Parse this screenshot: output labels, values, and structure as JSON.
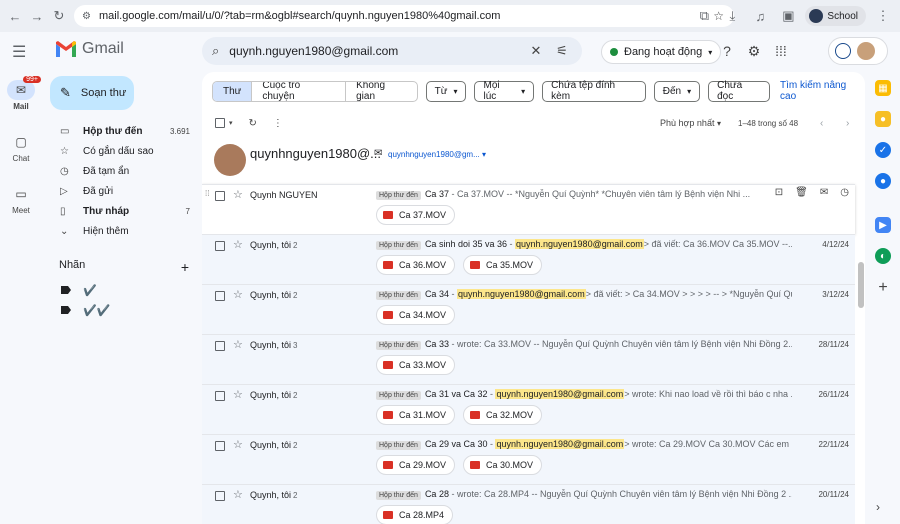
{
  "browser": {
    "url": "mail.google.com/mail/u/0/?tab=rm&ogbl#search/quynh.nguyen1980%40gmail.com",
    "profile": "School"
  },
  "app": {
    "logo": "Gmail",
    "search_query": "quynh.nguyen1980@gmail.com",
    "status": "Đang hoạt động"
  },
  "rail": [
    {
      "label": "Mail",
      "badge": "99+"
    },
    {
      "label": "Chat"
    },
    {
      "label": "Meet"
    }
  ],
  "compose_label": "Soạn thư",
  "nav": [
    {
      "icon": "inbox-icon",
      "glyph": "▭",
      "label": "Hộp thư đến",
      "count": "3.691",
      "bold": true
    },
    {
      "icon": "star-icon",
      "glyph": "☆",
      "label": "Có gắn dấu sao",
      "count": ""
    },
    {
      "icon": "clock-icon",
      "glyph": "◷",
      "label": "Đã tạm ẩn",
      "count": ""
    },
    {
      "icon": "send-icon",
      "glyph": "▷",
      "label": "Đã gửi",
      "count": ""
    },
    {
      "icon": "draft-icon",
      "glyph": "▯",
      "label": "Thư nháp",
      "count": "7",
      "bold": true
    },
    {
      "icon": "chevron-down-icon",
      "glyph": "⌄",
      "label": "Hiện thêm",
      "count": ""
    }
  ],
  "labels": {
    "title": "Nhãn",
    "items": [
      "✔️",
      "✔️✔️"
    ]
  },
  "filters": {
    "tabs": [
      "Thư",
      "Cuộc trò chuyện",
      "Không gian"
    ],
    "chips": [
      "Từ",
      "Mọi lúc",
      "Chứa tệp đính kèm",
      "Đến",
      "Chưa đọc"
    ],
    "advanced": "Tìm kiếm nâng cao"
  },
  "toolbar": {
    "sort": "Phù hợp nhất",
    "count": "1–48 trong số 48"
  },
  "contact": {
    "name": "quynhnguyen1980@...",
    "email": "quynhnguyen1980@gm..."
  },
  "emails": [
    {
      "from": "Quynh NGUYEN",
      "n": "",
      "label": "Hộp thư đến",
      "subject": "Ca 37",
      "pre": " - Ca 37.MOV -- *Nguyễn Quí Quỳnh* *Chuyên viên tâm lý Bệnh viện Nhi ...",
      "hl": "",
      "post": "",
      "date": "",
      "attachments": [
        "Ca 37.MOV"
      ]
    },
    {
      "from": "Quynh, tôi",
      "n": "2",
      "label": "Hộp thư đến",
      "subject": "Ca sinh doi 35 va 36",
      "pre": " - ",
      "hl": "quynh.nguyen1980@gmail.com",
      "post": "> đã viết: Ca 36.MOV Ca 35.MOV --...",
      "date": "4/12/24",
      "attachments": [
        "Ca 36.MOV",
        "Ca 35.MOV"
      ]
    },
    {
      "from": "Quynh, tôi",
      "n": "2",
      "label": "Hộp thư đến",
      "subject": "Ca 34",
      "pre": " - ",
      "hl": "quynh.nguyen1980@gmail.com",
      "post": "> đã viết: > Ca 34.MOV > > > > -- > *Nguyễn Quí Qu...",
      "date": "3/12/24",
      "attachments": [
        "Ca 34.MOV"
      ]
    },
    {
      "from": "Quynh, tôi",
      "n": "3",
      "label": "Hộp thư đến",
      "subject": "Ca 33",
      "pre": " - wrote: Ca 33.MOV -- Nguyễn Quí Quỳnh Chuyên viên tâm lý Bệnh viện Nhi Đồng 2...",
      "hl": "",
      "post": "",
      "date": "28/11/24",
      "attachments": [
        "Ca 33.MOV"
      ]
    },
    {
      "from": "Quynh, tôi",
      "n": "2",
      "label": "Hộp thư đến",
      "subject": "Ca 31 va Ca 32",
      "pre": " - ",
      "hl": "quynh.nguyen1980@gmail.com",
      "post": "> wrote: Khi nao load về rồi thì báo c nha ...",
      "date": "26/11/24",
      "attachments": [
        "Ca 31.MOV",
        "Ca 32.MOV"
      ]
    },
    {
      "from": "Quynh, tôi",
      "n": "2",
      "label": "Hộp thư đến",
      "subject": "Ca 29 va Ca 30",
      "pre": " - ",
      "hl": "quynh.nguyen1980@gmail.com",
      "post": "> wrote: Ca 29.MOV Ca 30.MOV Các em l...",
      "date": "22/11/24",
      "attachments": [
        "Ca 29.MOV",
        "Ca 30.MOV"
      ]
    },
    {
      "from": "Quynh, tôi",
      "n": "2",
      "label": "Hộp thư đến",
      "subject": "Ca 28",
      "pre": " - wrote: Ca 28.MP4 -- Nguyễn Quí Quỳnh Chuyên viên tâm lý Bệnh viện Nhi Đồng 2 ...",
      "hl": "",
      "post": "",
      "date": "20/11/24",
      "attachments": [
        "Ca 28.MP4"
      ]
    }
  ],
  "colors": {
    "accent": "#0b57d0",
    "compose": "#c2e7ff",
    "highlight": "#fce68b",
    "video": "#d93025"
  }
}
